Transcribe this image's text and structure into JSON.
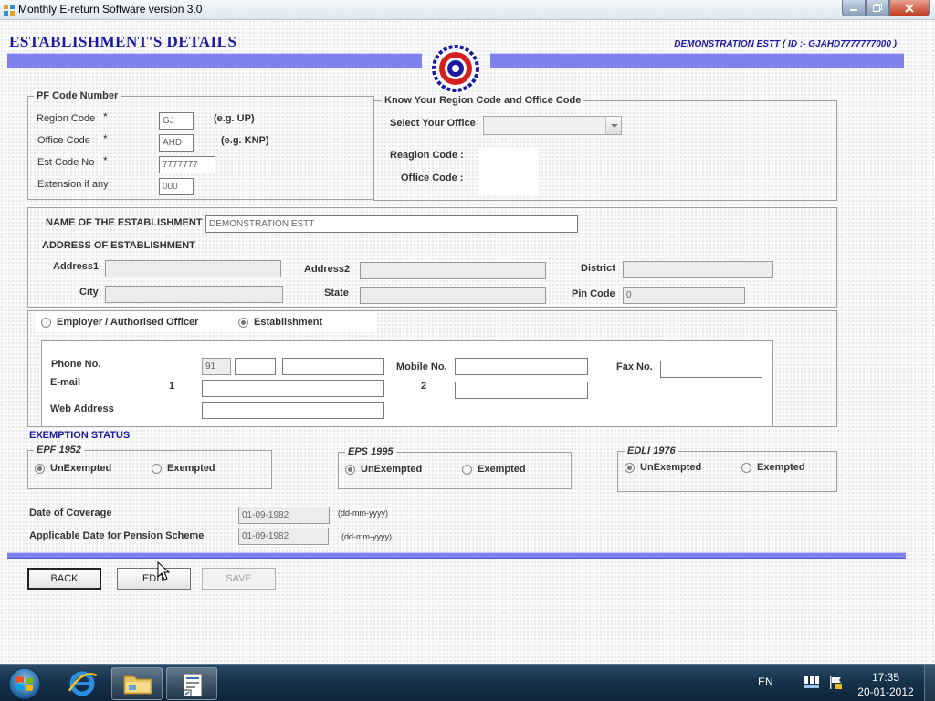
{
  "window": {
    "title": "Monthly E-return Software version 3.0"
  },
  "header": {
    "page_title": "ESTABLISHMENT'S  DETAILS",
    "estt_id": "DEMONSTRATION ESTT ( ID :- GJAHD7777777000 )"
  },
  "pf_code": {
    "legend": "PF Code Number",
    "region_label": "Region Code",
    "region_value": "GJ",
    "region_hint": "(e.g. UP)",
    "office_label": "Office Code",
    "office_value": "AHD",
    "office_hint": "(e.g. KNP)",
    "est_label": "Est Code No",
    "est_value": "7777777",
    "ext_label": "Extension if any",
    "ext_value": "000",
    "asterisk": "*"
  },
  "know_region": {
    "legend": "Know Your  Region Code and Office Code",
    "select_label": "Select Your Office",
    "select_value": "",
    "reagion_label": "Reagion Code :",
    "office_label": "Office Code :"
  },
  "establishment": {
    "name_label": "NAME OF THE ESTABLISHMENT",
    "name_value": "DEMONSTRATION ESTT",
    "address_heading": "ADDRESS OF ESTABLISHMENT",
    "address1_label": "Address1",
    "address1_value": "",
    "address2_label": "Address2",
    "address2_value": "",
    "district_label": "District",
    "district_value": "",
    "city_label": "City",
    "city_value": "",
    "state_label": "State",
    "state_value": "",
    "pin_label": "Pin Code",
    "pin_value": "0"
  },
  "contact": {
    "employer_radio": "Employer / Authorised Officer",
    "establishment_radio": "Establishment",
    "selected": "establishment",
    "phone_label": "Phone No.",
    "phone_country": "91",
    "phone_area": "",
    "phone_number": "",
    "mobile_label": "Mobile No.",
    "mobile_value": "",
    "fax_label": "Fax No.",
    "fax_value": "",
    "email_label": "E-mail",
    "email_1_label": "1",
    "email_1_value": "",
    "email_2_label": "2",
    "email_2_value": "",
    "web_label": "Web Address",
    "web_value": ""
  },
  "exemption": {
    "heading": "EXEMPTION STATUS",
    "groups": [
      {
        "legend": "EPF 1952",
        "unexempted": "UnExempted",
        "exempted": "Exempted",
        "selected": "unexempted"
      },
      {
        "legend": "EPS 1995",
        "unexempted": "UnExempted",
        "exempted": "Exempted",
        "selected": "unexempted"
      },
      {
        "legend": "EDLI 1976",
        "unexempted": "UnExempted",
        "exempted": "Exempted",
        "selected": "unexempted"
      }
    ]
  },
  "dates": {
    "coverage_label": "Date of Coverage",
    "coverage_value": "01-09-1982",
    "coverage_hint": "(dd-mm-yyyy)",
    "pension_label": "Applicable Date for Pension Scheme",
    "pension_value": "01-09-1982",
    "pension_hint": "(dd-mm-yyyy)"
  },
  "buttons": {
    "back": "BACK",
    "edit": "EDIT",
    "save": "SAVE"
  },
  "taskbar": {
    "lang": "EN",
    "time": "17:35",
    "date": "20-01-2012",
    "items": [
      "windows-start",
      "internet-explorer",
      "file-explorer",
      "e-return-app"
    ]
  },
  "colors": {
    "accent": "#1a1aa0",
    "band": "#8080ee"
  }
}
